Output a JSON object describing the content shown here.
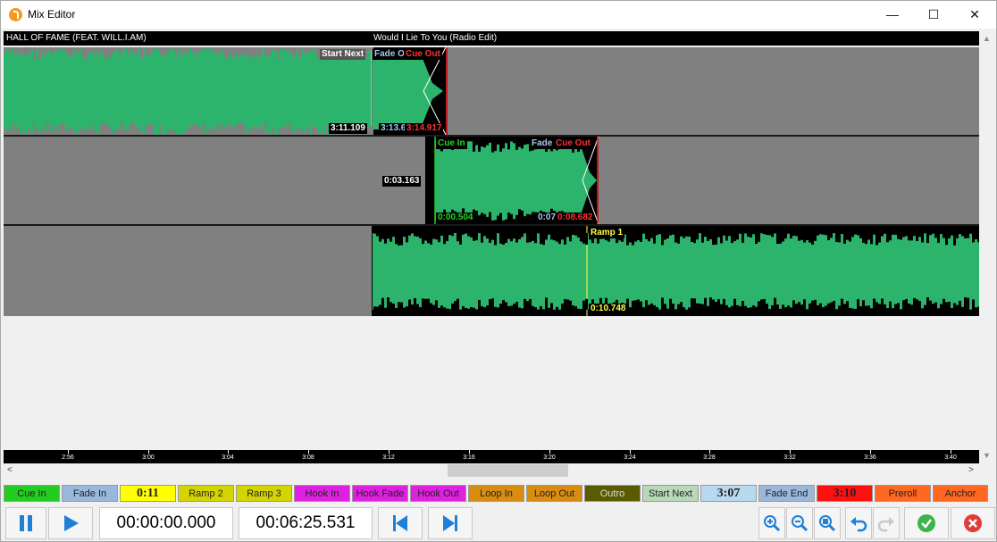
{
  "window": {
    "title": "Mix Editor",
    "minimize_glyph": "—",
    "maximize_glyph": "☐",
    "close_glyph": "✕"
  },
  "tracks": {
    "track1_title": "HALL OF FAME (FEAT. WILL.I.AM)",
    "track2_title": "Would I Lie To You (Radio Edit)",
    "t1": {
      "start_next": "Start Next",
      "fade": "Fade Out",
      "cue_out": "Cue Out",
      "time_start_next": "3:11.109",
      "time_fade": "3:13.6",
      "time_cue_out": "3:14.917"
    },
    "t2": {
      "offset": "0:03.163",
      "cue_in": "Cue In",
      "fade": "Fade",
      "cue_out": "Cue Out",
      "time_cue_in": "0:00.504",
      "time_fade": "0:07",
      "time_cue_out": "0:08.682"
    },
    "t3": {
      "ramp": "Ramp 1",
      "time_ramp": "0:10.748"
    }
  },
  "ruler": {
    "ticks": [
      "2:56",
      "3:00",
      "3:04",
      "3:08",
      "3:12",
      "3:16",
      "3:20",
      "3:24",
      "3:28",
      "3:32",
      "3:36",
      "3:40"
    ]
  },
  "markers": [
    {
      "label": "Cue In",
      "color": "#22cc22"
    },
    {
      "label": "Fade In",
      "color": "#9ab8dc"
    },
    {
      "label": "0:11",
      "color": "#ffff00"
    },
    {
      "label": "Ramp 2",
      "color": "#d4d400"
    },
    {
      "label": "Ramp 3",
      "color": "#d4d400"
    },
    {
      "label": "Hook In",
      "color": "#e020e0"
    },
    {
      "label": "Hook Fade",
      "color": "#e020e0"
    },
    {
      "label": "Hook Out",
      "color": "#e020e0"
    },
    {
      "label": "Loop In",
      "color": "#d88c10"
    },
    {
      "label": "Loop Out",
      "color": "#d88c10"
    },
    {
      "label": "Outro",
      "color": "#5a5a00"
    },
    {
      "label": "Start Next",
      "color": "#b8d8b8"
    },
    {
      "label": "3:07",
      "color": "#b8d8f0"
    },
    {
      "label": "Fade End",
      "color": "#9ab8dc"
    },
    {
      "label": "3:10",
      "color": "#ff1010"
    },
    {
      "label": "Preroll",
      "color": "#ff6820"
    },
    {
      "label": "Anchor",
      "color": "#ff6820"
    }
  ],
  "transport": {
    "position": "00:00:00.000",
    "duration": "00:06:25.531"
  },
  "colors": {
    "wave": "#2db46c",
    "track_bg": "#808080",
    "accent_blue": "#1e7fd8",
    "confirm_green": "#3cb44b",
    "cancel_red": "#e23b3b"
  }
}
